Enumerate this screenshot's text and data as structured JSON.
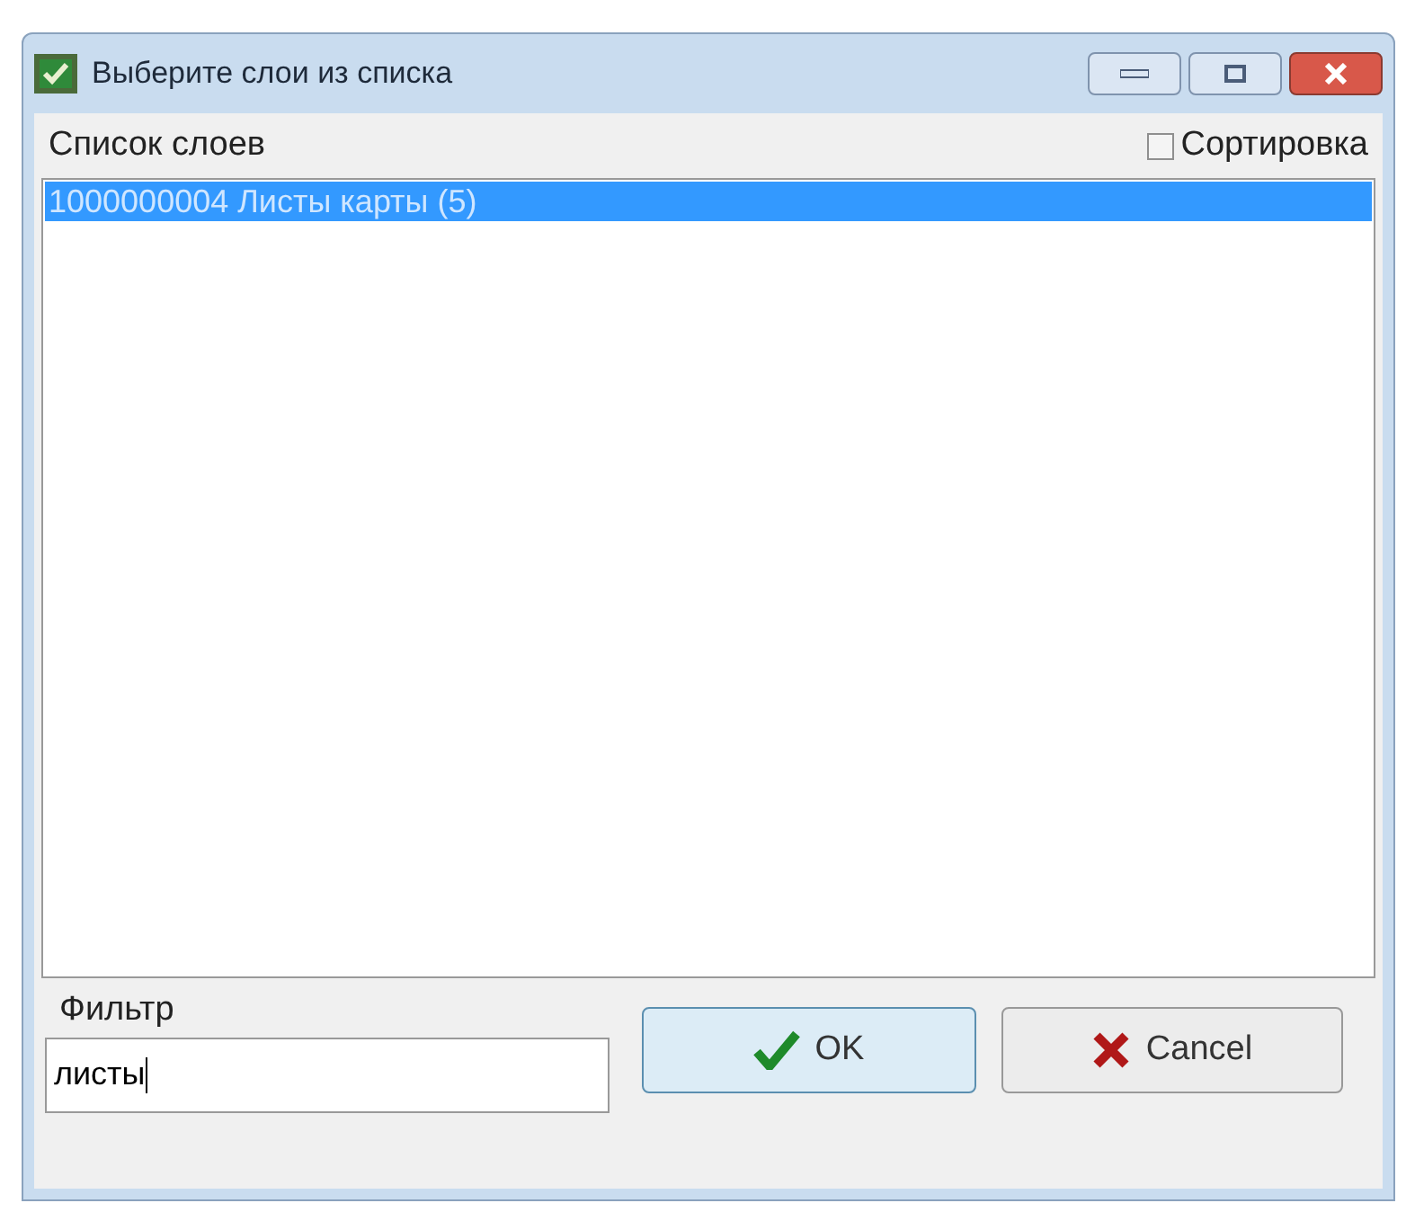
{
  "window": {
    "title": "Выберите слои из списка"
  },
  "list": {
    "label": "Список слоев",
    "sort_checkbox": {
      "label": "Сортировка",
      "checked": false
    },
    "items": [
      {
        "text": "1000000004 Листы карты (5)",
        "selected": true
      }
    ]
  },
  "filter": {
    "label": "Фильтр",
    "value": "листы"
  },
  "buttons": [
    {
      "kind": "ok",
      "label": "OK"
    },
    {
      "kind": "cancel",
      "label": "Cancel"
    }
  ]
}
